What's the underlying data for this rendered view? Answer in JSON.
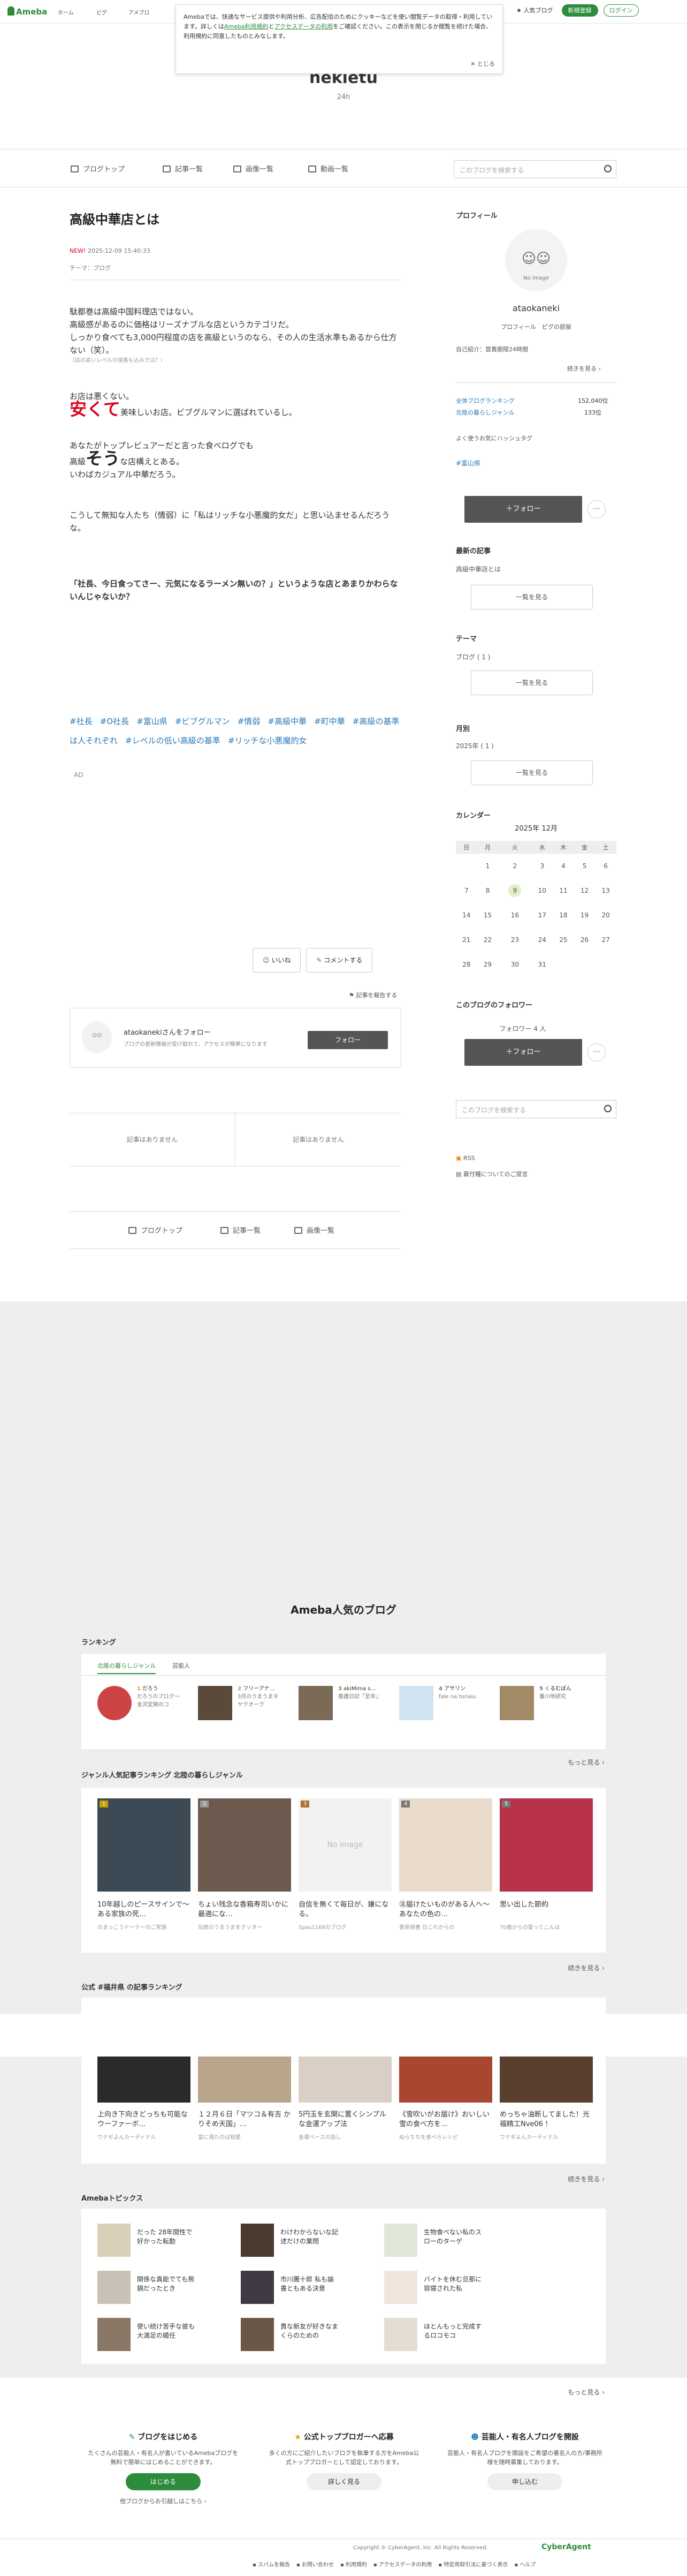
{
  "topbar": {
    "logo": "Ameba",
    "nav": [
      "ホーム",
      "ピグ",
      "アメブロ"
    ],
    "popular_blog": "人気ブログ",
    "register": "新規登録",
    "login": "ログイン"
  },
  "cookie": {
    "text1": "Amebaでは、快適なサービス提供や利用分析、広告配信のためにクッキーなどを使い閲覧データの取得・利用しています。詳しくは",
    "link1": "Ameba利用規約",
    "and": "と",
    "link2": "アクセスデータの利用",
    "text2": "をご確認ください。この表示を閉じるか閲覧を続けた場合、利用規約に同意したものとみなします。",
    "close": "とじる"
  },
  "blog": {
    "title": "nekietu",
    "subtitle": "24h"
  },
  "nav": {
    "top": "ブログトップ",
    "list": "記事一覧",
    "images": "画像一覧",
    "videos": "動画一覧",
    "search_placeholder": "このブログを検索する"
  },
  "article": {
    "title": "高級中華店とは",
    "new_badge": "NEW!",
    "date": "2025-12-09 15:40:33",
    "theme": "テーマ：ブログ",
    "p1": "駄都巻は高級中国料理店ではない。",
    "p2": "高級感があるのに価格はリーズナブルな店というカテゴリだ。",
    "p3": "しっかり食べても3,000円程度の店を高級というのなら、その人の生活水準もあるから仕方ない（笑）。",
    "caption": "（店の高いレベルの接客も込みでは？）",
    "p4": "お店は悪くない。",
    "p5a": "安くて",
    "p5b": "美味しいお店。ビブグルマンに選ばれているし。",
    "p6": "あなたがトップレビュアーだと言った食べログでも",
    "p7a": "高級",
    "p7b": "そう",
    "p7c": "な店構えとある。",
    "p8": "いわばカジュアル中華だろう。",
    "p9": "こうして無知な人たち（情弱）に「私はリッチな小悪魔的女だ」と思い込ませるんだろうな。",
    "p10": "「社長、今日食ってさー、元気になるラーメン無いの？」というような店とあまりかわらないんじゃないか？",
    "tags": [
      "#社長",
      "#O社長",
      "#富山県",
      "#ビブグルマン",
      "#情弱",
      "#高級中華",
      "#町中華",
      "#高級の基準は人それぞれ",
      "#レベルの低い高級の基準",
      "#リッチな小悪魔的女"
    ],
    "ad": "AD",
    "like": "いいね",
    "comment": "コメントする",
    "report": "記事を報告する"
  },
  "followcard": {
    "text": "ataokanekiさんをフォロー",
    "sub": "ブログの更新情報が受け取れて、アクセスが簡単になります",
    "button": "フォロー"
  },
  "prevnext": {
    "prev": "記事はありません",
    "next": "記事はありません"
  },
  "bottomnav": {
    "top": "ブログトップ",
    "list": "記事一覧",
    "images": "画像一覧"
  },
  "sidebar": {
    "profile_h": "プロフィール",
    "no_image": "No image",
    "name": "ataokaneki",
    "profile_link": "プロフィール",
    "pigg_link": "ピグの部屋",
    "self_intro": "自己紹介：賞費期限24時間",
    "more": "続きを見る",
    "rank_all_label": "全体ブログランキング",
    "rank_all_val": "152,040位",
    "rank_genre_label": "北陸の暮らしジャンル",
    "rank_genre_val": "133位",
    "hashtag_h": "よく使うお気にハッシュタグ",
    "hashtag": "#富山県",
    "follow": "＋フォロー",
    "latest_h": "最新の記事",
    "latest_item": "高級中華店とは",
    "list_btn": "一覧を見る",
    "theme_h": "テーマ",
    "theme_item": "ブログ ( 1 )",
    "month_h": "月別",
    "month_item": "2025年 ( 1 )",
    "cal_h": "カレンダー",
    "cal_title": "2025年 12月",
    "weekdays": [
      "日",
      "月",
      "火",
      "水",
      "木",
      "金",
      "土"
    ],
    "weeks": [
      [
        "",
        "1",
        "2",
        "3",
        "4",
        "5",
        "6"
      ],
      [
        "7",
        "8",
        "9",
        "10",
        "11",
        "12",
        "13"
      ],
      [
        "14",
        "15",
        "16",
        "17",
        "18",
        "19",
        "20"
      ],
      [
        "21",
        "22",
        "23",
        "24",
        "25",
        "26",
        "27"
      ],
      [
        "28",
        "29",
        "30",
        "31",
        "",
        "",
        ""
      ]
    ],
    "followers_h": "このブログのフォロワー",
    "followers": "フォロワー 4 人",
    "search_placeholder": "このブログを検索する",
    "rss": "RSS",
    "hint": "最付種についてのご提言"
  },
  "popular": {
    "title": "Ameba人気のブログ",
    "ranking_h": "ランキング",
    "tab1": "北陸の暮らしジャンル",
    "tab2": "芸能人",
    "ranking": [
      {
        "name": "だろう",
        "desc": "だろうのブログ〜金沢定期のコ"
      },
      {
        "name": "フリーアナ…",
        "desc": "3月のうまうまタ ヤクオーク"
      },
      {
        "name": "akiMima s…",
        "desc": "看護日記「至幸」"
      },
      {
        "name": "アサリン",
        "desc": "fale na toriaiu"
      },
      {
        "name": "くるむぽん",
        "desc": "番川地研究"
      }
    ],
    "more": "もっと見る",
    "genre_h": "ジャンル人気記事ランキング 北陸の暮らしジャンル",
    "genre": [
      {
        "rank": "1",
        "cap": "10年越しのピースサインで〜ある家族の死…",
        "sub": "のまっこうドーテーのご家族"
      },
      {
        "rank": "2",
        "cap": "ちょい残念な香箱寿司いかに最適にな…",
        "sub": "伝統のうまうまをクッター"
      },
      {
        "rank": "3",
        "cap": "自信を無くて毎日が、嫌になる。",
        "sub": "Spas1168のブログ"
      },
      {
        "rank": "4",
        "cap": "㊟届けたいものがある人へ〜あなたの色の…",
        "sub": "香泉経書 日これからの"
      },
      {
        "rank": "5",
        "cap": "思い出した節約",
        "sub": "70歳からの誓ってこんは"
      }
    ],
    "no_image": "No image",
    "more_genre": "続きを見る",
    "public_h": "公式 #福井県 の記事ランキング",
    "public": [
      {
        "cap": "上向き下向きどっちも可能なウーファーボ…",
        "sub": "ウナギよんカーディナル"
      },
      {
        "cap": "１２月６日「マツコ＆有吉 かりそめ天国」…",
        "sub": "富に満たのは知愛"
      },
      {
        "cap": "5円玉を玄関に置くシンプルな金運アップ法",
        "sub": "金運ベースの話し"
      },
      {
        "cap": "《雪吹いがお届け》おいしい雪の食べ方を…",
        "sub": "ぬらちちを食べらレシピ"
      },
      {
        "cap": "めっちゃ油断してました！光福精工Nve06 !",
        "sub": "ウナギよんカーディナル"
      }
    ],
    "more_public": "続きを見る",
    "topics_h": "Amebaトピックス",
    "topics": [
      "だった 28年間性で好かった転勤",
      "わけわからないな記述だけの業問",
      "生物食べない私のスローのターゲ",
      "関係な真能でても熊鍋だったとき",
      "市川團十郎 私も論書ともある決意",
      "バイトを休む旦那に容寝された私",
      "使い続け苦手な彼も大満足の婚任",
      "貴な新友が好きなまくらのための",
      "ほとんもっと完成するロコモコ"
    ],
    "more_topics": "もっと見る"
  },
  "footer": {
    "col1_h": "ブログをはじめる",
    "col1_t": "たくさんの芸能人・有名人が書いているAmebaブログを無料で簡単にはじめることができます。",
    "col1_btn": "はじめる",
    "col1_link": "他ブログからお引越しはこちら",
    "col2_h": "公式トップブロガーへ応募",
    "col2_t": "多くの方にご紹介したいブログを執筆する方をAmeba公式トップブロガーとして認定しております。",
    "col2_btn": "詳しく見る",
    "col3_h": "芸能人・有名人ブログを開設",
    "col3_t": "芸能人・有名人ブログを開設をご希望の著名人の方/事務所様を随時募集しております。",
    "col3_btn": "申し込む",
    "links": [
      "スパムを報告",
      "お問い合わせ",
      "利用規約",
      "アクセスデータの利用",
      "特定商取引法に基づく表示",
      "ヘルプ"
    ],
    "copyright": "Copyright © CyberAgent, Inc. All Rights Reserved.",
    "brand": "CyberAgent"
  },
  "colors": {
    "green": "#2d8c3c",
    "tag_blue": "#2b7bb9",
    "red": "#e0001d"
  }
}
